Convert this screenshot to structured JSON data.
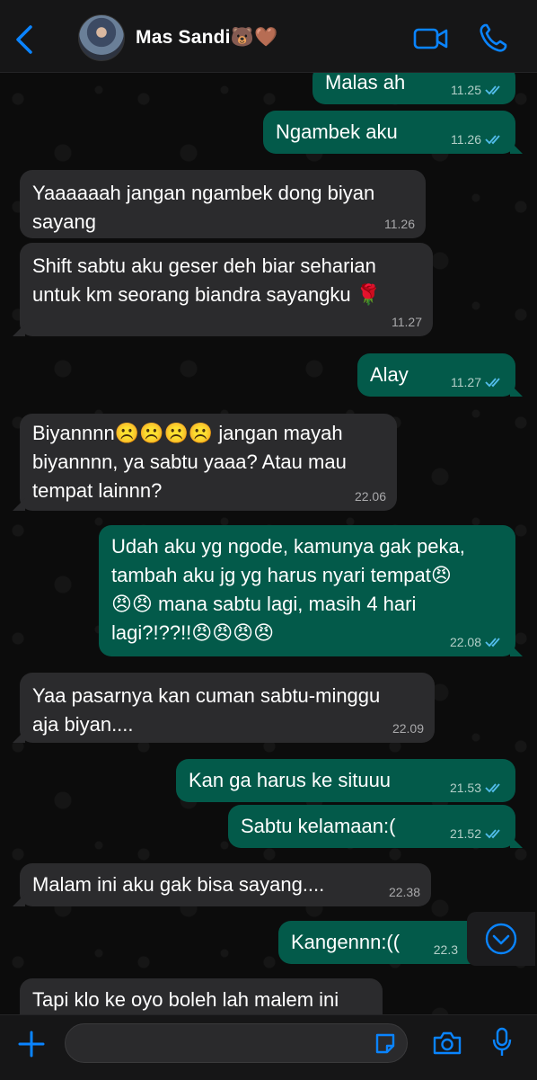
{
  "header": {
    "contact_name": "Mas Sandi🐻🤎",
    "icons": {
      "back": "chevron-left-icon",
      "video": "video-camera-icon",
      "call": "phone-icon"
    },
    "accent_color": "#0a84ff"
  },
  "messages": [
    {
      "dir": "out",
      "text": "Malas ah",
      "time": "11.25",
      "read": true
    },
    {
      "dir": "out",
      "text": "Ngambek aku",
      "time": "11.26",
      "read": true
    },
    {
      "dir": "in",
      "text": "Yaaaaaah jangan ngambek dong biyan\nsayang",
      "time": "11.26"
    },
    {
      "dir": "in",
      "text": "Shift sabtu aku geser deh biar seharian\nuntuk km seorang biandra sayangku 🌹",
      "time": "11.27"
    },
    {
      "dir": "out",
      "text": "Alay",
      "time": "11.27",
      "read": true
    },
    {
      "dir": "in",
      "text": "Biyannnn☹️☹️☹️☹️ jangan mayah\nbiyannnn, ya sabtu yaaa? Atau mau\ntempat lainnn?",
      "time": "22.06"
    },
    {
      "dir": "out",
      "text": "Udah aku yg ngode, kamunya gak peka,\ntambah aku jg yg harus nyari tempat😠\n😠😠 mana sabtu lagi, masih 4 hari\nlagi?!??!!😠😠😠😠",
      "time": "22.08",
      "read": true
    },
    {
      "dir": "in",
      "text": "Yaa pasarnya kan cuman sabtu-minggu\naja biyan....",
      "time": "22.09"
    },
    {
      "dir": "out",
      "text": "Kan ga harus ke situuu",
      "time": "21.53",
      "read": true
    },
    {
      "dir": "out",
      "text": "Sabtu kelamaan:(",
      "time": "21.52",
      "read": true
    },
    {
      "dir": "in",
      "text": "Malam ini aku gak bisa sayang....",
      "time": "22.38"
    },
    {
      "dir": "out",
      "text": "Kangennn:((",
      "time": "22.3",
      "read": true
    },
    {
      "dir": "in",
      "text": "Tapi klo ke oyo boleh lah malem ini",
      "time": ""
    }
  ],
  "input": {
    "placeholder": ""
  },
  "colors": {
    "bubble_in": "#2b2b2d",
    "bubble_out": "#035a4a",
    "read_ticks": "#53bdeb"
  }
}
